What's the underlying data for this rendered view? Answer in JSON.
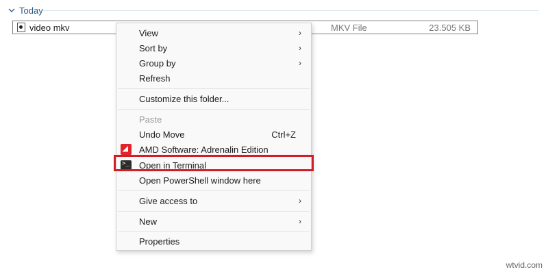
{
  "group": {
    "label": "Today"
  },
  "file": {
    "name": "video mkv",
    "type": "MKV File",
    "size": "23.505 KB"
  },
  "menu": {
    "items": [
      {
        "label": "View",
        "shortcut": "",
        "has_submenu": true,
        "disabled": false
      },
      {
        "label": "Sort by",
        "shortcut": "",
        "has_submenu": true,
        "disabled": false
      },
      {
        "label": "Group by",
        "shortcut": "",
        "has_submenu": true,
        "disabled": false
      },
      {
        "label": "Refresh",
        "shortcut": "",
        "has_submenu": false,
        "disabled": false
      },
      {
        "label": "Customize this folder...",
        "shortcut": "",
        "has_submenu": false,
        "disabled": false
      },
      {
        "label": "Paste",
        "shortcut": "",
        "has_submenu": false,
        "disabled": true
      },
      {
        "label": "Undo Move",
        "shortcut": "Ctrl+Z",
        "has_submenu": false,
        "disabled": false
      },
      {
        "label": "AMD Software: Adrenalin Edition",
        "icon": "amd-icon",
        "shortcut": "",
        "has_submenu": false,
        "disabled": false
      },
      {
        "label": "Open in Terminal",
        "icon": "terminal-icon",
        "shortcut": "",
        "has_submenu": false,
        "disabled": false,
        "highlighted": true
      },
      {
        "label": "Open PowerShell window here",
        "shortcut": "",
        "has_submenu": false,
        "disabled": false
      },
      {
        "label": "Give access to",
        "shortcut": "",
        "has_submenu": true,
        "disabled": false
      },
      {
        "label": "New",
        "shortcut": "",
        "has_submenu": true,
        "disabled": false
      },
      {
        "label": "Properties",
        "shortcut": "",
        "has_submenu": false,
        "disabled": false
      }
    ],
    "submenu_arrow": "›",
    "amd_glyph": "◢",
    "terminal_glyph": ">_"
  },
  "colors": {
    "highlight_border": "#d01d26",
    "amd_red": "#e2232a",
    "group_header": "#2a5a86"
  },
  "watermark": "wtvid.com"
}
